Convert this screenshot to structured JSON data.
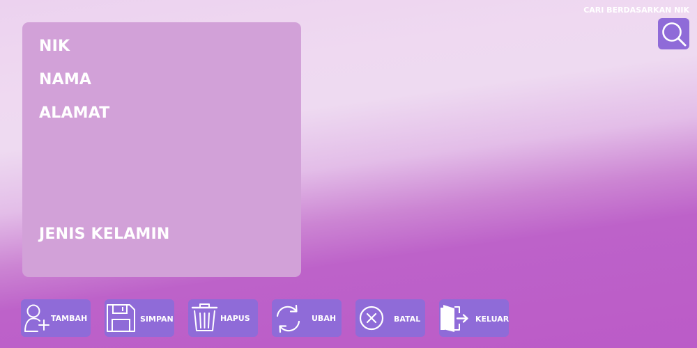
{
  "form": {
    "nik_label": "NIK",
    "nama_label": "NAMA",
    "alamat_label": "ALAMAT",
    "jenis_kelamin_label": "JENIS KELAMIN"
  },
  "search": {
    "caption": "CARI BERDASARKAN NIK",
    "icon": "search-icon"
  },
  "toolbar": {
    "tambah_label": "TAMBAH",
    "simpan_label": "SIMPAN",
    "hapus_label": "HAPUS",
    "ubah_label": "UBAH",
    "batal_label": "BATAL",
    "keluar_label": "KELUAR",
    "icons": [
      "add-user-icon",
      "save-icon",
      "trash-icon",
      "refresh-icon",
      "cancel-icon",
      "exit-icon"
    ]
  },
  "colors": {
    "button_bg": "#8f6bd8",
    "panel_bg": "#d2a1d8",
    "bg_top": "#ecd2ef",
    "bg_bottom": "#bb5bc8",
    "text": "#ffffff"
  }
}
